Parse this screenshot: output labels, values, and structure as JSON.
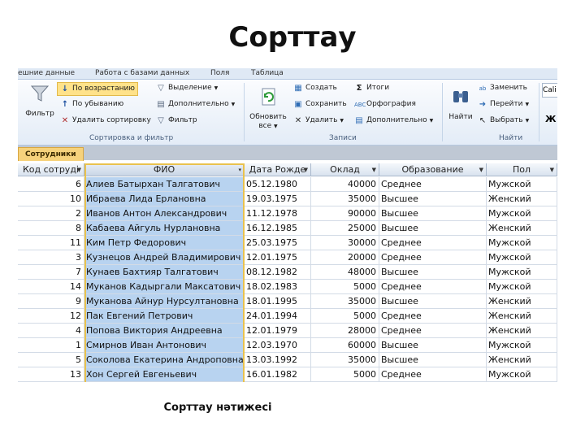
{
  "slide": {
    "title": "Сорттау",
    "caption": "Сорттау нәтижесі"
  },
  "ribbon": {
    "tabs": [
      "ешние данные",
      "Работа с базами данных",
      "Поля",
      "Таблица"
    ],
    "sort_filter": {
      "filter": "Фильтр",
      "ascending": "По возрастанию",
      "descending": "По убыванию",
      "clear_sort": "Удалить сортировку",
      "selection": "Выделение",
      "advanced": "Дополнительно",
      "toggle_filter": "Фильтр",
      "label": "Сортировка и фильтр"
    },
    "records": {
      "refresh": "Обновить",
      "refresh_all": "все",
      "new": "Создать",
      "save": "Сохранить",
      "delete": "Удалить",
      "totals": "Итоги",
      "spelling": "Орфография",
      "more": "Дополнительно",
      "label": "Записи"
    },
    "find": {
      "find": "Найти",
      "replace": "Заменить",
      "goto": "Перейти",
      "select": "Выбрать",
      "label": "Найти"
    },
    "font": {
      "name": "Cali",
      "bold": "Ж"
    }
  },
  "object_tab": "Сотрудники",
  "table": {
    "columns": [
      "Код сотруді",
      "ФИО",
      "Дата Рожде",
      "Оклад",
      "Образование",
      "Пол"
    ],
    "rows": [
      [
        "6",
        "Алиев Батырхан Талгатович",
        "05.12.1980",
        "40000",
        "Среднее",
        "Мужской"
      ],
      [
        "10",
        "Ибраева Лида Ерлановна",
        "19.03.1975",
        "35000",
        "Высшее",
        "Женский"
      ],
      [
        "2",
        "Иванов Антон Александрович",
        "11.12.1978",
        "90000",
        "Высшее",
        "Мужской"
      ],
      [
        "8",
        "Кабаева Айгуль Нурлановна",
        "16.12.1985",
        "25000",
        "Высшее",
        "Женский"
      ],
      [
        "11",
        "Ким Петр Федорович",
        "25.03.1975",
        "30000",
        "Среднее",
        "Мужской"
      ],
      [
        "3",
        "Кузнецов Андрей Владимирович",
        "12.01.1975",
        "20000",
        "Среднее",
        "Мужской"
      ],
      [
        "7",
        "Кунаев Бахтияр Талгатович",
        "08.12.1982",
        "48000",
        "Высшее",
        "Мужской"
      ],
      [
        "14",
        "Муканов Кадыргали Максатович",
        "18.02.1983",
        "5000",
        "Среднее",
        "Мужской"
      ],
      [
        "9",
        "Муканова Айнур Нурсултановна",
        "18.01.1995",
        "35000",
        "Высшее",
        "Женский"
      ],
      [
        "12",
        "Пак Евгений Петрович",
        "24.01.1994",
        "5000",
        "Среднее",
        "Женский"
      ],
      [
        "4",
        "Попова Виктория Андреевна",
        "12.01.1979",
        "28000",
        "Среднее",
        "Женский"
      ],
      [
        "1",
        "Смирнов Иван Антонович",
        "12.03.1970",
        "60000",
        "Высшее",
        "Мужской"
      ],
      [
        "5",
        "Соколова Екатерина Андроповна",
        "13.03.1992",
        "35000",
        "Высшее",
        "Женский"
      ],
      [
        "13",
        "Хон Сергей Евгеньевич",
        "16.01.1982",
        "5000",
        "Среднее",
        "Мужской"
      ]
    ]
  }
}
